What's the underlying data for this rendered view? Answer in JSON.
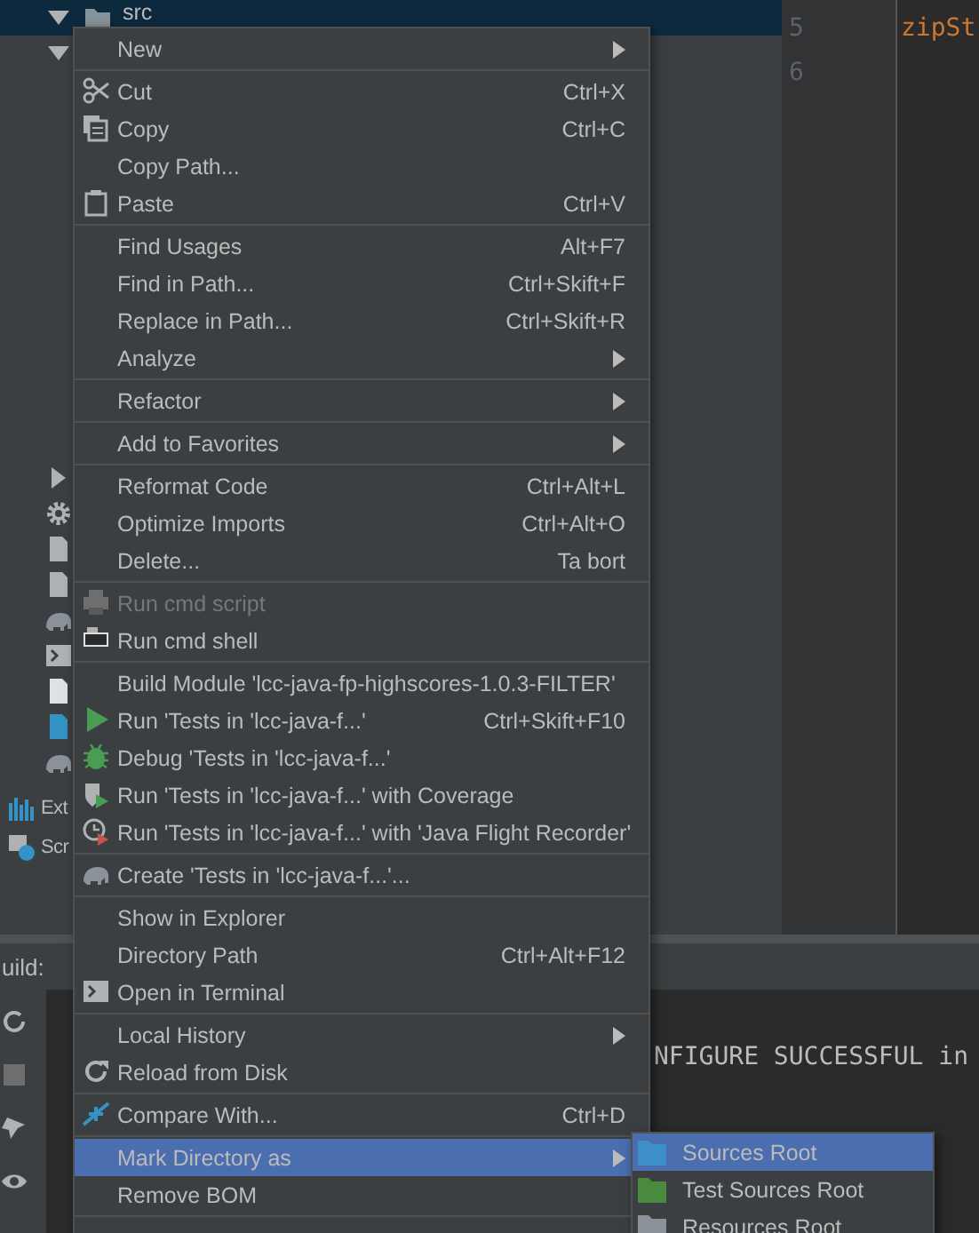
{
  "project_tree": {
    "root": {
      "label": "src",
      "selected": true,
      "expanded": true
    },
    "side_labels": [
      "Ext",
      "Scr"
    ]
  },
  "editor": {
    "line_numbers": [
      "5",
      "6"
    ],
    "code": "zipSt"
  },
  "build_panel": {
    "title": "uild:",
    "console_line": "NFIGURE SUCCESSFUL in"
  },
  "context_menu": {
    "groups": [
      [
        {
          "label": "New",
          "submenu": true,
          "selected": false,
          "disabled": false
        }
      ],
      [
        {
          "label": "Cut",
          "shortcut": "Ctrl+X",
          "submenu": false,
          "selected": false,
          "disabled": false
        },
        {
          "label": "Copy",
          "shortcut": "Ctrl+C",
          "submenu": false,
          "selected": false,
          "disabled": false
        },
        {
          "label": "Copy Path...",
          "submenu": false,
          "selected": false,
          "disabled": false
        },
        {
          "label": "Paste",
          "shortcut": "Ctrl+V",
          "submenu": false,
          "selected": false,
          "disabled": false
        }
      ],
      [
        {
          "label": "Find Usages",
          "shortcut": "Alt+F7",
          "submenu": false,
          "selected": false,
          "disabled": false
        },
        {
          "label": "Find in Path...",
          "shortcut": "Ctrl+Skift+F",
          "submenu": false,
          "selected": false,
          "disabled": false
        },
        {
          "label": "Replace in Path...",
          "shortcut": "Ctrl+Skift+R",
          "submenu": false,
          "selected": false,
          "disabled": false
        },
        {
          "label": "Analyze",
          "submenu": true,
          "selected": false,
          "disabled": false
        }
      ],
      [
        {
          "label": "Refactor",
          "submenu": true,
          "selected": false,
          "disabled": false
        }
      ],
      [
        {
          "label": "Add to Favorites",
          "submenu": true,
          "selected": false,
          "disabled": false
        }
      ],
      [
        {
          "label": "Reformat Code",
          "shortcut": "Ctrl+Alt+L",
          "submenu": false,
          "selected": false,
          "disabled": false
        },
        {
          "label": "Optimize Imports",
          "shortcut": "Ctrl+Alt+O",
          "submenu": false,
          "selected": false,
          "disabled": false
        },
        {
          "label": "Delete...",
          "shortcut": "Ta bort",
          "submenu": false,
          "selected": false,
          "disabled": false
        }
      ],
      [
        {
          "label": "Run cmd script",
          "submenu": false,
          "selected": false,
          "disabled": true
        },
        {
          "label": "Run cmd shell",
          "submenu": false,
          "selected": false,
          "disabled": false
        }
      ],
      [
        {
          "label": "Build Module 'lcc-java-fp-highscores-1.0.3-FILTER'",
          "submenu": false,
          "selected": false,
          "disabled": false
        },
        {
          "label": "Run 'Tests in 'lcc-java-f...'",
          "shortcut": "Ctrl+Skift+F10",
          "submenu": false,
          "selected": false,
          "disabled": false
        },
        {
          "label": "Debug 'Tests in 'lcc-java-f...'",
          "submenu": false,
          "selected": false,
          "disabled": false
        },
        {
          "label": "Run 'Tests in 'lcc-java-f...' with Coverage",
          "submenu": false,
          "selected": false,
          "disabled": false
        },
        {
          "label": "Run 'Tests in 'lcc-java-f...' with 'Java Flight Recorder'",
          "submenu": false,
          "selected": false,
          "disabled": false
        }
      ],
      [
        {
          "label": "Create 'Tests in 'lcc-java-f...'...",
          "submenu": false,
          "selected": false,
          "disabled": false
        }
      ],
      [
        {
          "label": "Show in Explorer",
          "submenu": false,
          "selected": false,
          "disabled": false
        },
        {
          "label": "Directory Path",
          "shortcut": "Ctrl+Alt+F12",
          "submenu": false,
          "selected": false,
          "disabled": false
        },
        {
          "label": "Open in Terminal",
          "submenu": false,
          "selected": false,
          "disabled": false
        }
      ],
      [
        {
          "label": "Local History",
          "submenu": true,
          "selected": false,
          "disabled": false
        },
        {
          "label": "Reload from Disk",
          "submenu": false,
          "selected": false,
          "disabled": false
        }
      ],
      [
        {
          "label": "Compare With...",
          "shortcut": "Ctrl+D",
          "submenu": false,
          "selected": false,
          "disabled": false
        }
      ],
      [
        {
          "label": "Mark Directory as",
          "submenu": true,
          "selected": true,
          "disabled": false
        },
        {
          "label": "Remove BOM",
          "submenu": false,
          "selected": false,
          "disabled": false
        }
      ]
    ]
  },
  "submenu": {
    "items": [
      {
        "label": "Sources Root",
        "color": "#3d8fc9",
        "selected": true
      },
      {
        "label": "Test Sources Root",
        "color": "#4a8a3c",
        "selected": false
      },
      {
        "label": "Resources Root",
        "color": "#8c9299",
        "selected": false
      }
    ]
  }
}
